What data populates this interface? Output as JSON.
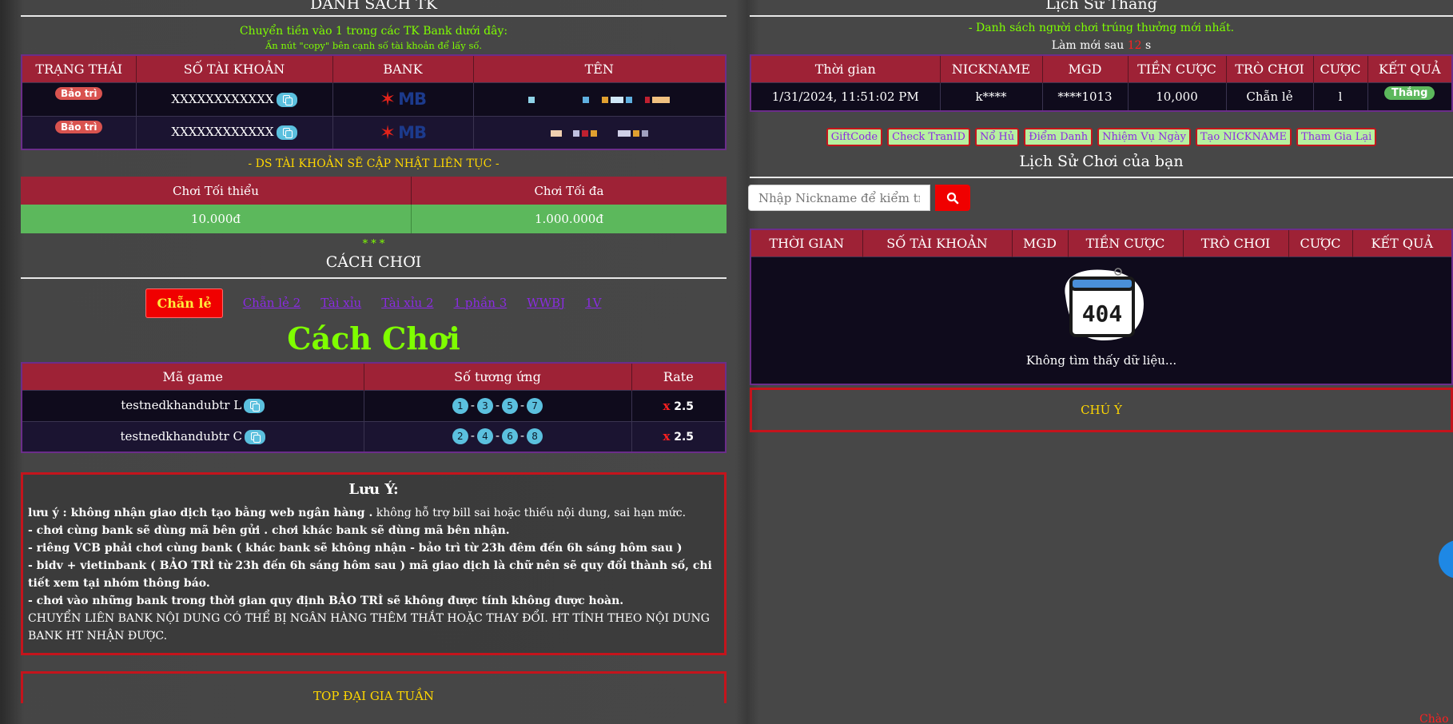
{
  "left": {
    "accounts_title": "DANH SÁCH TK",
    "transfer_hint": "Chuyển tiền vào 1 trong các TK Bank dưới đây:",
    "copy_hint": "Ấn nút \"copy\" bên cạnh số tài khoản để lấy số.",
    "account_headers": [
      "TRẠNG THÁI",
      "SỐ TÀI KHOẢN",
      "BANK",
      "TÊN"
    ],
    "accounts": [
      {
        "status": "Bảo trì",
        "number": "XXXXXXXXXXXX",
        "bank": "MB"
      },
      {
        "status": "Bảo trì",
        "number": "XXXXXXXXXXXX",
        "bank": "MB"
      }
    ],
    "update_note": "- DS TÀI KHOẢN SẼ CẬP NHẬT LIÊN TỤC -",
    "limit_headers": [
      "Chơi Tối thiểu",
      "Chơi Tối đa"
    ],
    "limits": [
      "10.000đ",
      "1.000.000đ"
    ],
    "stars": "* * *",
    "howto_title": "CÁCH CHƠI",
    "tabs": [
      "Chẵn lẻ",
      "Chẵn lẻ 2",
      "Tài xỉu",
      "Tài xỉu 2",
      "1 phần 3",
      "WWBJ",
      "1V"
    ],
    "big_title": "Cách Chơi",
    "game_headers": [
      "Mã game",
      "Số tương ứng",
      "Rate"
    ],
    "games": [
      {
        "code": "testnedkhandubtr L",
        "numbers": [
          "1",
          "3",
          "5",
          "7"
        ],
        "rate_x": "x",
        "rate": "2.5"
      },
      {
        "code": "testnedkhandubtr C",
        "numbers": [
          "2",
          "4",
          "6",
          "8"
        ],
        "rate_x": "x",
        "rate": "2.5"
      }
    ],
    "note": {
      "title": "Lưu Ý:",
      "line1_bold": "lưu ý : không nhận giao dịch tạo bằng web ngân hàng .",
      "line1_rest": " không hỗ trợ bill sai hoặc thiếu nội dung, sai hạn mức.",
      "line2": "- chơi cùng bank sẽ dùng mã bên gửi . chơi khác bank sẽ dùng mã bên nhận.",
      "line3": "- riêng VCB phải chơi cùng bank ( khác bank sẽ không nhận - bảo trì từ 23h đêm đến 6h sáng hôm sau )",
      "line4": "-  bidv + vietinbank ( BẢO TRÌ từ 23h đến 6h sáng hôm sau ) mã giao dịch là chữ nên sẽ quy đổi thành số, chi tiết xem tại nhóm thông báo.",
      "line5": "- chơi vào những bank trong thời gian quy định BẢO TRÌ sẽ không được tính không được hoàn.",
      "line6": " CHUYỂN LIÊN BANK NỘI DUNG CÓ THỂ BỊ NGÂN HÀNG THÊM THẮT HOẶC THAY ĐỔI. HT TÍNH THEO NỘI DUNG BANK HT NHẬN ĐƯỢC."
    },
    "top_title": "TOP ĐẠI GIA TUẦN"
  },
  "right": {
    "wins_title": "Lịch Sử Thắng",
    "wins_sub": "- Danh sách người chơi trúng thưởng mới nhất.",
    "refresh_prefix": "Làm mới sau",
    "refresh_count": "12",
    "refresh_suffix": "s",
    "win_headers": [
      "Thời gian",
      "NICKNAME",
      "MGD",
      "TIỀN CƯỢC",
      "TRÒ CHƠI",
      "CƯỢC",
      "KẾT QUẢ"
    ],
    "wins": [
      {
        "time": "1/31/2024, 11:51:02 PM",
        "nickname": "k****",
        "mgd": "****1013",
        "amount": "10,000",
        "game": "Chẵn lẻ",
        "bet": "l",
        "result": "Thắng"
      }
    ],
    "buttons": [
      "GiftCode",
      "Check TranID",
      "Nổ Hủ",
      "Điểm Danh",
      "Nhiệm Vụ Ngày",
      "Tạo NICKNAME",
      "Tham Gia Lại"
    ],
    "history_title": "Lịch Sử Chơi của bạn",
    "search_placeholder": "Nhập Nickname để kiểm tra",
    "history_headers": [
      "THỜI GIAN",
      "SỐ TÀI KHOẢN",
      "MGD",
      "TIỀN CƯỢC",
      "TRÒ CHƠI",
      "CƯỢC",
      "KẾT QUẢ"
    ],
    "empty_code": "404",
    "empty_text": "Không tìm thấy dữ liệu...",
    "notice_title": "CHÚ Ý",
    "corner_text": "Chào"
  },
  "colors": {
    "header_red": "#9e2236",
    "accent_green": "#7fff00",
    "status_red": "#d9534f",
    "win_green": "#5cb85c",
    "limit_green": "#5cb85c",
    "info_blue": "#5bc0de"
  }
}
